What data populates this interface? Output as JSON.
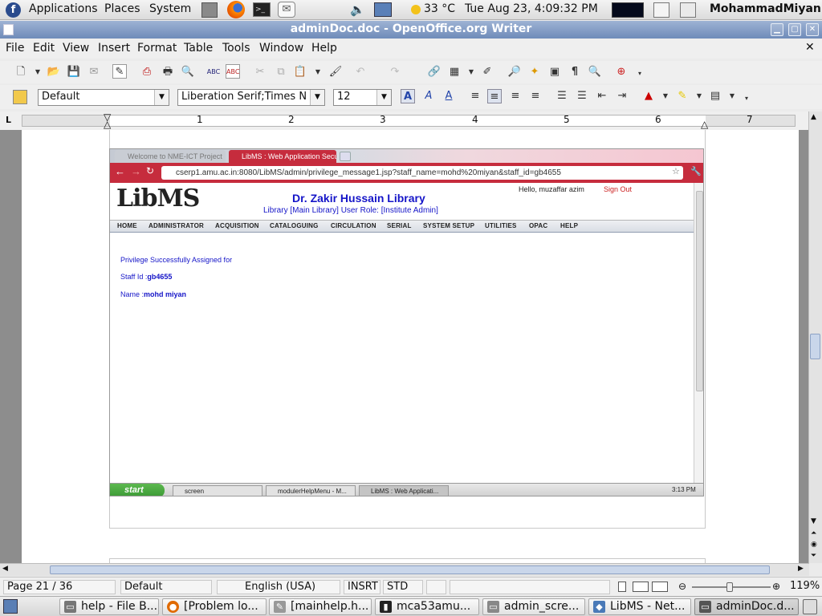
{
  "panel": {
    "menu": [
      "Applications",
      "Places",
      "System"
    ],
    "weather": "33 °C",
    "clock": "Tue Aug 23,  4:09:32 PM",
    "user": "MohammadMiyan"
  },
  "window": {
    "title": "adminDoc.doc - OpenOffice.org Writer",
    "menu": [
      "File",
      "Edit",
      "View",
      "Insert",
      "Format",
      "Table",
      "Tools",
      "Window",
      "Help"
    ]
  },
  "format_bar": {
    "style": "Default",
    "font": "Liberation Serif;Times N",
    "size": "12"
  },
  "ruler": {
    "labels": [
      "1",
      "2",
      "3",
      "4",
      "5",
      "6",
      "7"
    ]
  },
  "embedded": {
    "tabs": [
      "Welcome to NME-ICT Project",
      "LibMS : Web Application Secu"
    ],
    "url": "cserp1.amu.ac.in:8080/LibMS/admin/privilege_message1.jsp?staff_name=mohd%20miyan&staff_id=gb4655",
    "logo": "LibMS",
    "library_title": "Dr. Zakir Hussain Library",
    "library_sub": "Library [Main Library]  User Role: [Institute Admin]",
    "hello": "Hello,  muzaffar azim",
    "signout": "Sign Out",
    "nav": [
      "HOME",
      "ADMINISTRATOR",
      "ACQUISITION",
      "CATALOGUING",
      "CIRCULATION",
      "SERIAL",
      "SYSTEM SETUP",
      "UTILITIES",
      "OPAC",
      "HELP"
    ],
    "message": "Privilege Successfully Assigned for",
    "staff_id_label": "Staff Id :",
    "staff_id": "gb4655",
    "name_label": "Name :",
    "name": "mohd miyan",
    "xp_start": "start",
    "xp_tasks": [
      "screen",
      "modulerHelpMenu - M...",
      "LibMS : Web Applicati..."
    ],
    "xp_clock": "3:13 PM"
  },
  "status": {
    "page": "Page 21 / 36",
    "style": "Default",
    "language": "English (USA)",
    "insert": "INSRT",
    "selection": "STD",
    "zoom": "119%"
  },
  "taskbar": {
    "items": [
      "help - File B...",
      "[Problem lo...",
      "[mainhelp.h...",
      "mca53amu...",
      "admin_scre...",
      "LibMS - Net...",
      "adminDoc.d..."
    ]
  },
  "colors": {
    "title_bar": "#7a93c0",
    "chrome_address_bar": "#c62c3d",
    "libms_blue": "#1515c8",
    "xp_start": "#3c9a35"
  }
}
